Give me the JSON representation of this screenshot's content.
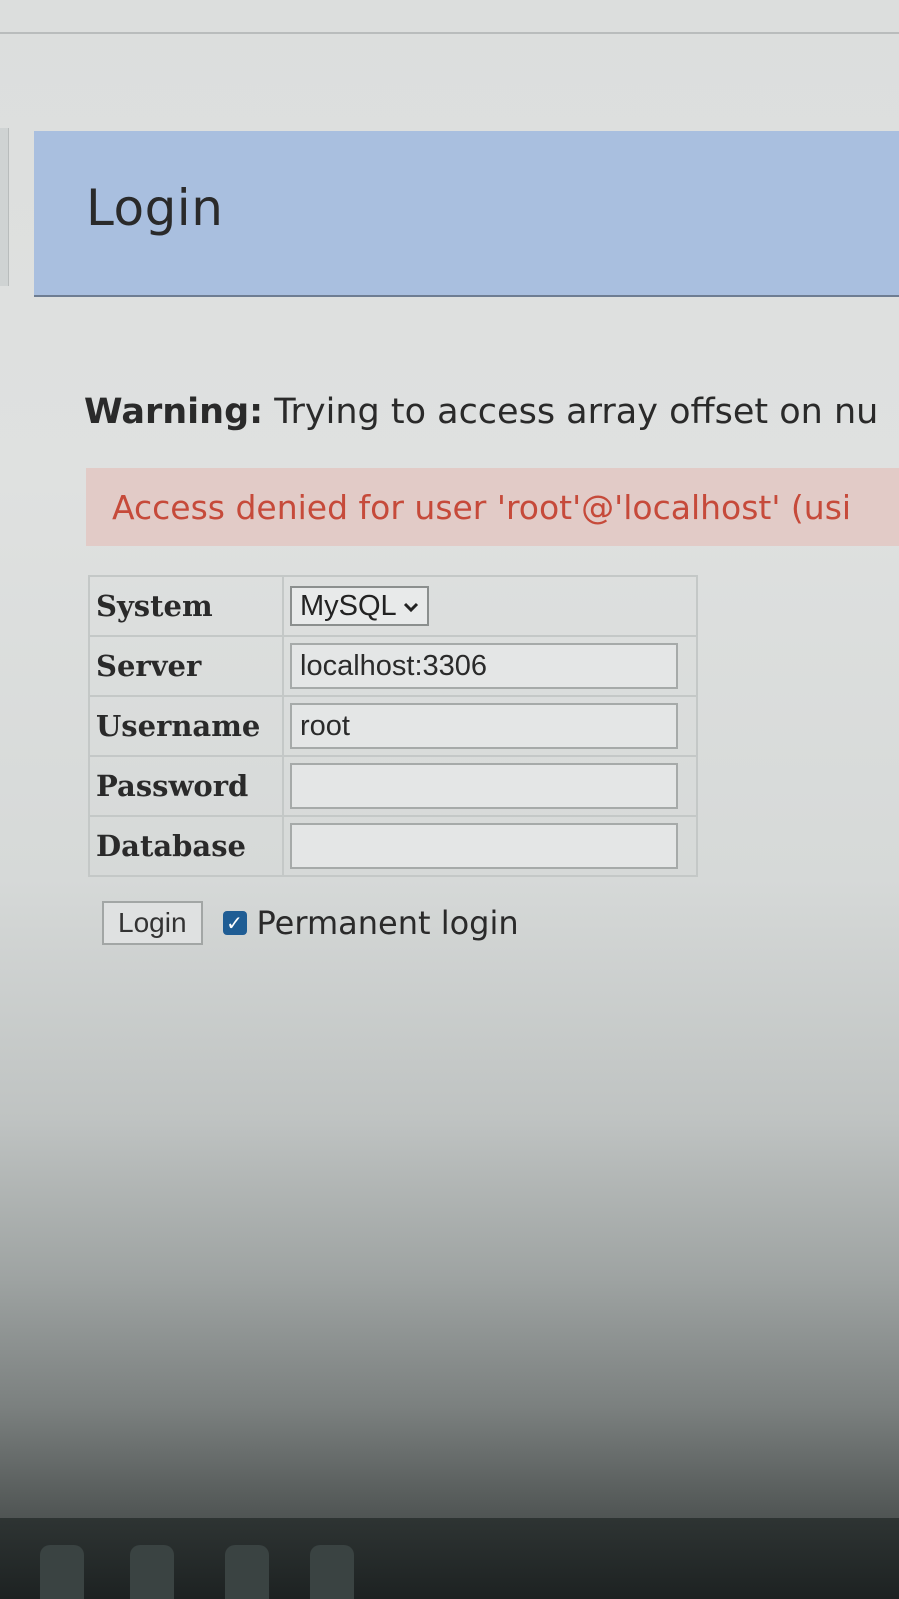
{
  "header": {
    "title": "Login"
  },
  "warning": {
    "label": "Warning:",
    "message": "Trying to access array offset on nu"
  },
  "error": {
    "message": "Access denied for user 'root'@'localhost' (usi"
  },
  "form": {
    "system": {
      "label": "System",
      "value": "MySQL"
    },
    "server": {
      "label": "Server",
      "value": "localhost:3306"
    },
    "username": {
      "label": "Username",
      "value": "root"
    },
    "password": {
      "label": "Password",
      "value": ""
    },
    "database": {
      "label": "Database",
      "value": ""
    }
  },
  "actions": {
    "login_label": "Login",
    "permanent_login_label": "Permanent login",
    "permanent_login_checked": true
  },
  "colors": {
    "header_bg": "#a9bfdf",
    "error_text": "#c64a3a",
    "error_bg": "#e2cbc7",
    "checkbox": "#1f5d94"
  },
  "icons": {
    "select_chevron": "chevron-down-icon",
    "checkbox_mark": "checkmark-icon"
  }
}
